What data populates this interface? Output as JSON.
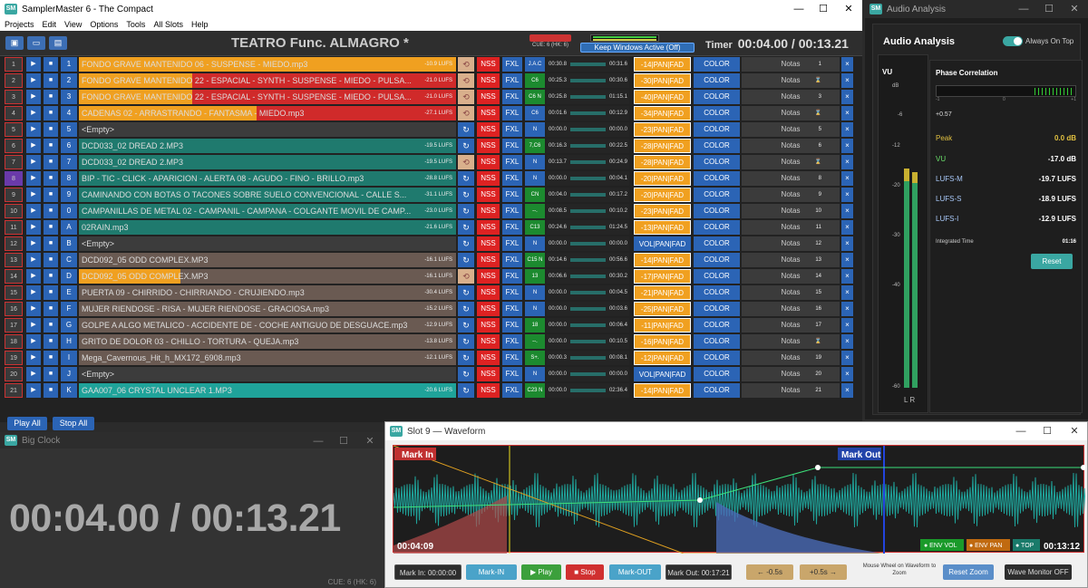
{
  "main": {
    "title": "SamplerMaster 6 - The Compact",
    "logo": "SM",
    "menu": [
      "Projects",
      "Edit",
      "View",
      "Options",
      "Tools",
      "All Slots",
      "Help"
    ],
    "show_title": "TEATRO Func. ALMAGRO  *",
    "cue": "CUE: 6 (HK: 6)",
    "kw_button": "Keep Windows Active (Off)",
    "timer_label": "Timer",
    "timer_value": "00:04.00 / 00:13.21",
    "play_all": "Play All",
    "stop_all": "Stop All"
  },
  "rows": [
    {
      "n": "1",
      "k": "1",
      "name": "FONDO GRAVE MANTENIDO 06 - SUSPENSE - MIEDO.mp3",
      "lufs": "-10.9 LUFS",
      "c": "J.A.C",
      "cg": false,
      "ws": "00:30.8",
      "we": "00:31.6",
      "pan": "-14|PAN|FAD",
      "pand": false,
      "notes": "Notas",
      "nn": "1",
      "bg": "#d02a2a",
      "fill": 1.0,
      "lp": "loop"
    },
    {
      "n": "2",
      "k": "2",
      "name": "FONDO GRAVE MANTENIDO 22 - ESPACIAL - SYNTH - SUSPENSE - MIEDO - PULSA...",
      "lufs": "-21.0 LUFS",
      "c": "C6",
      "cg": true,
      "ws": "00:25.3",
      "we": "00:30.6",
      "pan": "-30|PAN|FAD",
      "pand": false,
      "notes": "Notas",
      "nn": "⌛",
      "bg": "#d02a2a",
      "fill": 0.3,
      "lp": "loop"
    },
    {
      "n": "3",
      "k": "3",
      "name": "FONDO GRAVE MANTENIDO 22 - ESPACIAL - SYNTH - SUSPENSE - MIEDO - PULSA...",
      "lufs": "-21.0 LUFS",
      "c": "C6 N",
      "cg": true,
      "ws": "00:25.8",
      "we": "01:15.1",
      "pan": "-40|PAN|FAD",
      "pand": false,
      "notes": "Notas",
      "nn": "3",
      "bg": "#d02a2a",
      "fill": 0.3,
      "lp": "loop"
    },
    {
      "n": "4",
      "k": "4",
      "name": "CADENAS 02 - ARRASTRANDO  - FANTASMA - MIEDO.mp3",
      "lufs": "-27.1 LUFS",
      "c": "C6",
      "cg": false,
      "ws": "00:01.6",
      "we": "00:12.9",
      "pan": "-34|PAN|FAD",
      "pand": false,
      "notes": "Notas",
      "nn": "⌛",
      "bg": "#d02a2a",
      "fill": 0.47,
      "lp": "loop"
    },
    {
      "n": "5",
      "k": "5",
      "name": "<Empty>",
      "lufs": "",
      "c": "N",
      "cg": false,
      "ws": "00:00.0",
      "we": "00:00.0",
      "pan": "-23|PAN|FAD",
      "pand": false,
      "notes": "Notas",
      "nn": "5",
      "bg": "#3c3c3c",
      "fill": 0,
      "lp": "once"
    },
    {
      "n": "6",
      "k": "6",
      "name": "DCD033_02 DREAD 2.MP3",
      "lufs": "-19.5 LUFS",
      "c": "7,C6",
      "cg": true,
      "ws": "00:16.3",
      "we": "00:22.5",
      "pan": "-28|PAN|FAD",
      "pand": false,
      "notes": "Notas",
      "nn": "6",
      "bg": "#1f7a6e",
      "fill": 0,
      "lp": "once"
    },
    {
      "n": "7",
      "k": "7",
      "name": "DCD033_02 DREAD 2.MP3",
      "lufs": "-19.5 LUFS",
      "c": "N",
      "cg": false,
      "ws": "00:13.7",
      "we": "00:24.9",
      "pan": "-28|PAN|FAD",
      "pand": false,
      "notes": "Notas",
      "nn": "⌛",
      "bg": "#1f7a6e",
      "fill": 0,
      "lp": "loop"
    },
    {
      "n": "8",
      "k": "8",
      "name": "BIP - TIC - CLICK -  APARICION - ALERTA 08 - AGUDO - FINO - BRILLO.mp3",
      "lufs": "-28.8 LUFS",
      "c": "N",
      "cg": false,
      "ws": "00:00.0",
      "we": "00:04.1",
      "pan": "-20|PAN|FAD",
      "pand": false,
      "notes": "Notas",
      "nn": "8",
      "bg": "#1f7a6e",
      "fill": 0,
      "lp": "once"
    },
    {
      "n": "9",
      "k": "9",
      "name": "CAMINANDO CON BOTAS O TACONES  SOBRE SUELO CONVENCIONAL - CALLE S...",
      "lufs": "-31.1 LUFS",
      "c": "CN",
      "cg": true,
      "ws": "00:04.0",
      "we": "00:17.2",
      "pan": "-20|PAN|FAD",
      "pand": false,
      "notes": "Notas",
      "nn": "9",
      "bg": "#1f7a6e",
      "fill": 0,
      "lp": "once"
    },
    {
      "n": "10",
      "k": "0",
      "name": "CAMPANILLAS DE METAL 02 - CAMPANIL - CAMPANA - COLGANTE MOVIL DE CAMP...",
      "lufs": "-23.0 LUFS",
      "c": "--.",
      "cg": true,
      "ws": "00:08.5",
      "we": "00:10.2",
      "pan": "-23|PAN|FAD",
      "pand": false,
      "notes": "Notas",
      "nn": "10",
      "bg": "#1f7a6e",
      "fill": 0,
      "lp": "once"
    },
    {
      "n": "11",
      "k": "A",
      "name": "02RAIN.mp3",
      "lufs": "-21.6 LUFS",
      "c": "C13",
      "cg": true,
      "ws": "00:24.6",
      "we": "01:24.5",
      "pan": "-13|PAN|FAD",
      "pand": false,
      "notes": "Notas",
      "nn": "11",
      "bg": "#1f7a6e",
      "fill": 0,
      "lp": "once"
    },
    {
      "n": "12",
      "k": "B",
      "name": "<Empty>",
      "lufs": "",
      "c": "N",
      "cg": false,
      "ws": "00:00.0",
      "we": "00:00.0",
      "pan": "VOL|PAN|FAD",
      "pand": true,
      "notes": "Notas",
      "nn": "12",
      "bg": "#3c3c3c",
      "fill": 0,
      "lp": "once"
    },
    {
      "n": "13",
      "k": "C",
      "name": "DCD092_05 ODD COMPLEX.MP3",
      "lufs": "-16.1 LUFS",
      "c": "C15 N",
      "cg": true,
      "ws": "00:14.6",
      "we": "00:56.6",
      "pan": "-14|PAN|FAD",
      "pand": false,
      "notes": "Notas",
      "nn": "13",
      "bg": "#6a5a52",
      "fill": 0,
      "lp": "once"
    },
    {
      "n": "14",
      "k": "D",
      "name": "DCD092_05 ODD COMPLEX.MP3",
      "lufs": "-16.1 LUFS",
      "c": "13",
      "cg": true,
      "ws": "00:06.6",
      "we": "00:30.2",
      "pan": "-17|PAN|FAD",
      "pand": false,
      "notes": "Notas",
      "nn": "14",
      "bg": "#6a5a52",
      "fill": 0.27,
      "lp": "loop"
    },
    {
      "n": "15",
      "k": "E",
      "name": "PUERTA 09 - CHIRRIDO - CHIRRIANDO - CRUJIENDO.mp3",
      "lufs": "-30.4 LUFS",
      "c": "N",
      "cg": false,
      "ws": "00:00.0",
      "we": "00:04.5",
      "pan": "-21|PAN|FAD",
      "pand": false,
      "notes": "Notas",
      "nn": "15",
      "bg": "#6a5a52",
      "fill": 0,
      "lp": "once"
    },
    {
      "n": "16",
      "k": "F",
      "name": "MUJER RIENDOSE - RISA - MUJER RIENDOSE - GRACIOSA.mp3",
      "lufs": "-15.2 LUFS",
      "c": "N",
      "cg": false,
      "ws": "00:00.0",
      "we": "00:03.6",
      "pan": "-25|PAN|FAD",
      "pand": false,
      "notes": "Notas",
      "nn": "16",
      "bg": "#6a5a52",
      "fill": 0,
      "lp": "once"
    },
    {
      "n": "17",
      "k": "G",
      "name": "GOLPE A ALGO METALICO - ACCIDENTE DE - COCHE ANTIGUO DE DESGUACE.mp3",
      "lufs": "-12.9 LUFS",
      "c": "18",
      "cg": true,
      "ws": "00:00.0",
      "we": "00:06.4",
      "pan": "-11|PAN|FAD",
      "pand": false,
      "notes": "Notas",
      "nn": "17",
      "bg": "#6a5a52",
      "fill": 0,
      "lp": "once"
    },
    {
      "n": "18",
      "k": "H",
      "name": "GRITO DE DOLOR 03 - CHILLO - TORTURA - QUEJA.mp3",
      "lufs": "-13.8 LUFS",
      "c": "--.",
      "cg": true,
      "ws": "00:00.0",
      "we": "00:10.5",
      "pan": "-16|PAN|FAD",
      "pand": false,
      "notes": "Notas",
      "nn": "⌛",
      "bg": "#6a5a52",
      "fill": 0,
      "lp": "once"
    },
    {
      "n": "19",
      "k": "I",
      "name": "Mega_Cavernous_Hit_h_MX172_6908.mp3",
      "lufs": "-12.1 LUFS",
      "c": "S+.",
      "cg": true,
      "ws": "00:00.3",
      "we": "00:08.1",
      "pan": "-12|PAN|FAD",
      "pand": false,
      "notes": "Notas",
      "nn": "19",
      "bg": "#6a5a52",
      "fill": 0,
      "lp": "once"
    },
    {
      "n": "20",
      "k": "J",
      "name": "<Empty>",
      "lufs": "",
      "c": "N",
      "cg": false,
      "ws": "00:00.0",
      "we": "00:00.0",
      "pan": "VOL|PAN|FAD",
      "pand": true,
      "notes": "Notas",
      "nn": "20",
      "bg": "#3c3c3c",
      "fill": 0,
      "lp": "once"
    },
    {
      "n": "21",
      "k": "K",
      "name": "GAA007_06 CRYSTAL UNCLEAR 1.MP3",
      "lufs": "-20.6 LUFS",
      "c": "C23 N",
      "cg": true,
      "ws": "00:00.0",
      "we": "02:36.4",
      "pan": "-14|PAN|FAD",
      "pand": false,
      "notes": "Notas",
      "nn": "21",
      "bg": "#1fa39a",
      "fill": 0,
      "lp": "once"
    }
  ],
  "labels": {
    "nss": "NSS",
    "fxl": "FXL",
    "color": "COLOR",
    "x": "×",
    "play": "▶",
    "stop": "■"
  },
  "audio": {
    "title": "Audio Analysis",
    "heading": "Audio Analysis",
    "always_on_top": "Always On Top",
    "vu_label": "VU",
    "scale": [
      "dB",
      "-6",
      "-12",
      "-20",
      "-30",
      "-40",
      "-60"
    ],
    "phase_title": "Phase Correlation",
    "phase_value": "+0.57",
    "peak_label": "Peak",
    "peak_value": "0.0 dB",
    "vu_stat_label": "VU",
    "vu_stat_value": "-17.0 dB",
    "lufsm_label": "LUFS-M",
    "lufsm_value": "-19.7 LUFS",
    "lufss_label": "LUFS-S",
    "lufss_value": "-18.9 LUFS",
    "lufsi_label": "LUFS-I",
    "lufsi_value": "-12.9 LUFS",
    "it_label": "Integrated Time",
    "it_value": "01:16",
    "reset": "Reset",
    "lr": "L  R",
    "phase_ticks": [
      "-1",
      "0",
      "+1"
    ]
  },
  "clock": {
    "title": "Big Clock",
    "time": "00:04.00 / 00:13.21",
    "cue": "CUE: 6 (HK: 6)"
  },
  "waveform": {
    "title": "Slot 9 — Waveform",
    "mark_in": "Mark In",
    "mark_out": "Mark Out",
    "t_left": "00:04:09",
    "t_right": "00:13:12",
    "env_vol": "● ENV VOL",
    "env_pan": "● ENV PAN",
    "top": "● TOP",
    "btn_markin_time": "Mark In: 00:00:00",
    "btn_markin": "Mark-IN",
    "btn_play": "▶ Play",
    "btn_stop": "■ Stop",
    "btn_markout": "Mark-OUT",
    "btn_markout_time": "Mark Out: 00:17:21",
    "btn_back": "← -0.5s",
    "btn_fwd": "+0.5s →",
    "hint": "Mouse Wheel on Waveform to Zoom",
    "btn_reset_zoom": "Reset Zoom",
    "btn_monitor": "Wave Monitor OFF"
  }
}
